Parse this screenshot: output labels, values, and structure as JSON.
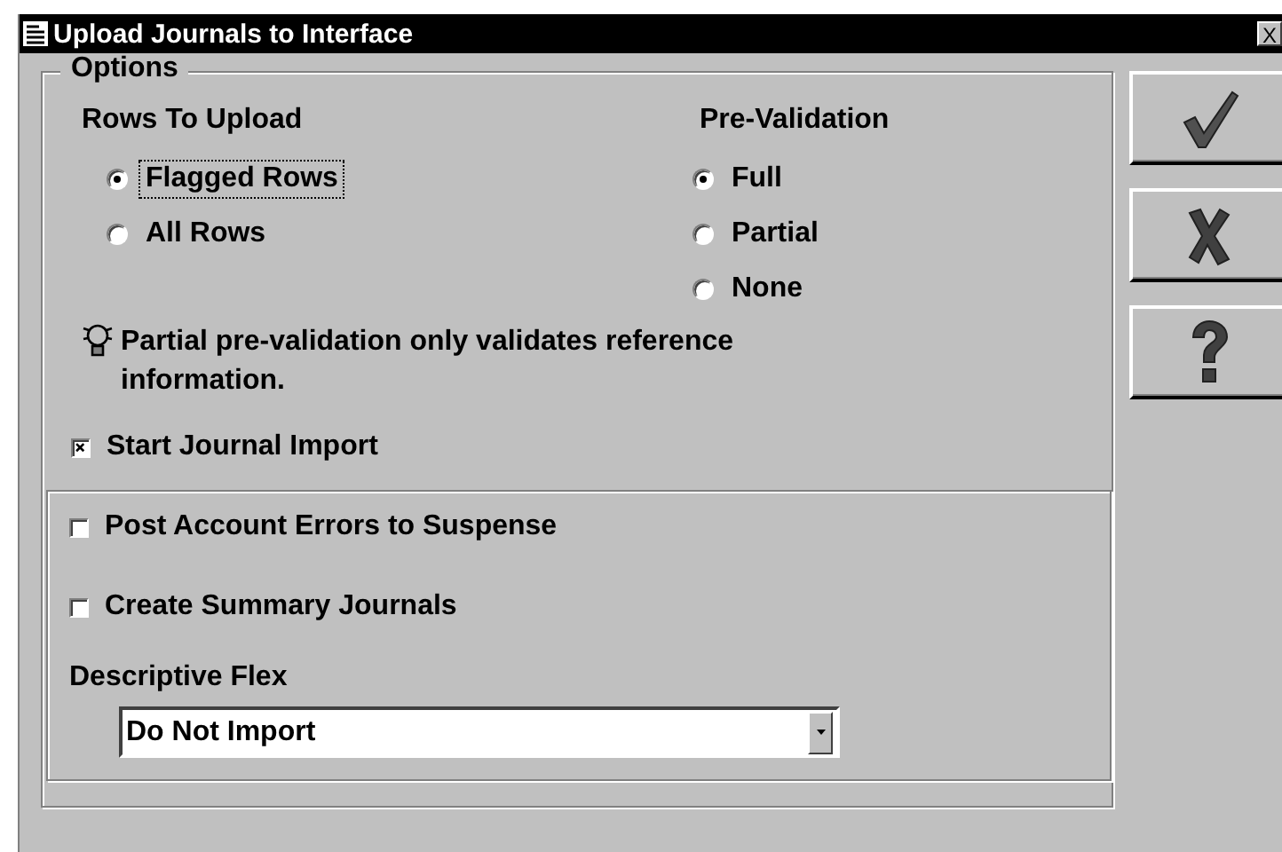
{
  "window": {
    "title": "Upload Journals to Interface",
    "close": "X"
  },
  "options": {
    "legend": "Options",
    "radio_groups": [
      {
        "label": "Rows To Upload",
        "options": [
          {
            "label": "Flagged Rows",
            "selected": true,
            "focused": true
          },
          {
            "label": "All Rows",
            "selected": false,
            "focused": false
          }
        ]
      },
      {
        "label": "Pre-Validation",
        "options": [
          {
            "label": "Full",
            "selected": true,
            "focused": false
          },
          {
            "label": "Partial",
            "selected": false,
            "focused": false
          },
          {
            "label": "None",
            "selected": false,
            "focused": false
          }
        ]
      }
    ],
    "hint": "Partial pre-validation only validates reference information.",
    "start_import": {
      "label": "Start Journal Import",
      "checked": true
    },
    "import_options": [
      {
        "label": "Post Account Errors to Suspense",
        "checked": false
      },
      {
        "label": "Create Summary Journals",
        "checked": false
      }
    ],
    "descriptive_flex": {
      "label": "Descriptive Flex",
      "value": "Do Not Import"
    }
  },
  "buttons": [
    {
      "kind": "ok"
    },
    {
      "kind": "cancel"
    },
    {
      "kind": "help"
    }
  ]
}
